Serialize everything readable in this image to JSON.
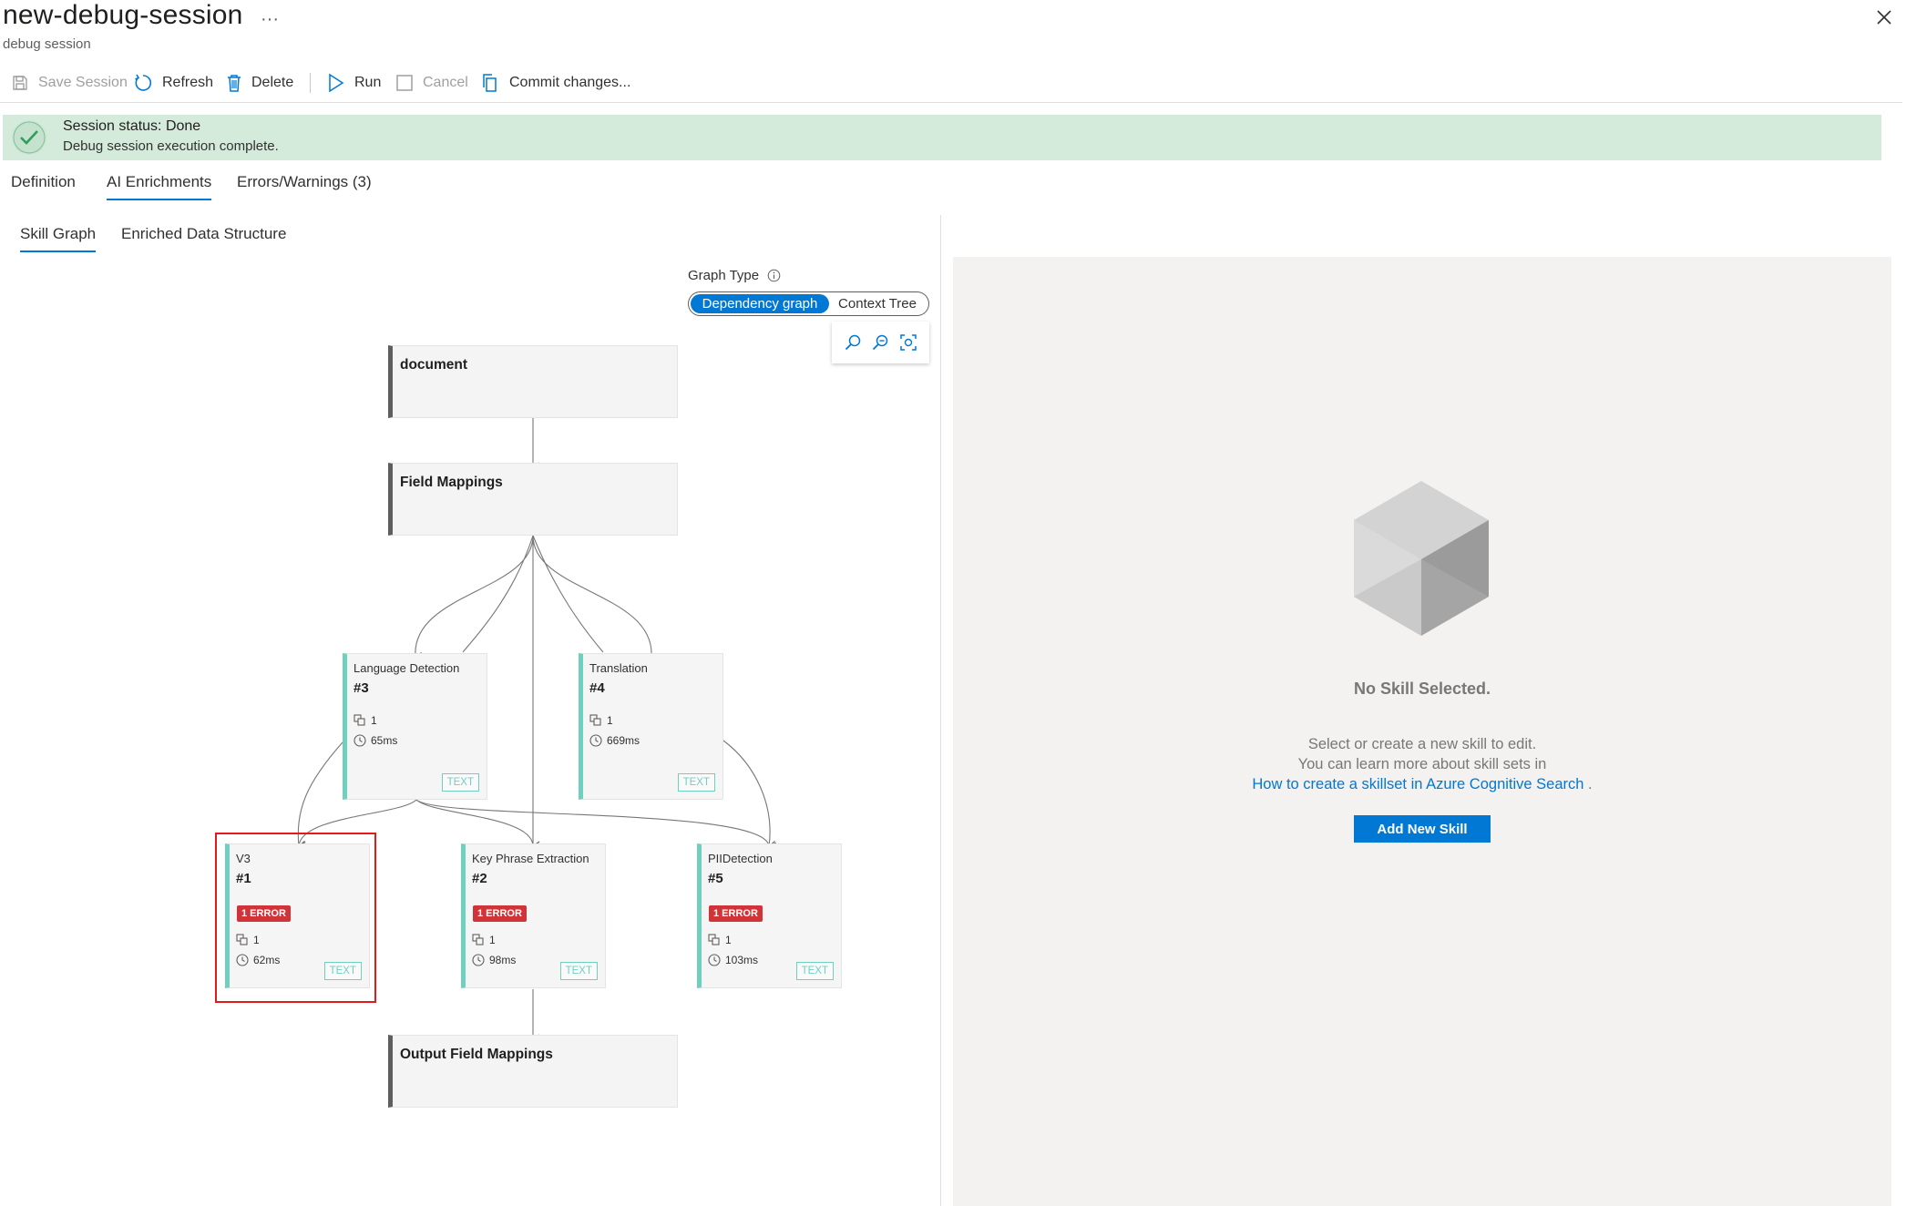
{
  "header": {
    "title": "new-debug-session",
    "subtitle": "debug session",
    "more_label": "···"
  },
  "toolbar": {
    "save_label": "Save Session",
    "refresh_label": "Refresh",
    "delete_label": "Delete",
    "run_label": "Run",
    "cancel_label": "Cancel",
    "commit_label": "Commit changes..."
  },
  "banner": {
    "title": "Session status: Done",
    "message": "Debug session execution complete."
  },
  "tabs": {
    "definition": "Definition",
    "ai_enrichments": "AI Enrichments",
    "errors": "Errors/Warnings (3)"
  },
  "subtabs": {
    "skill_graph": "Skill Graph",
    "enriched": "Enriched Data Structure"
  },
  "graph_type": {
    "label": "Graph Type",
    "dependency": "Dependency graph",
    "context_tree": "Context Tree"
  },
  "graph": {
    "document": "document",
    "field_mappings": "Field Mappings",
    "output_field_mappings": "Output Field Mappings",
    "skills": [
      {
        "name": "Language Detection",
        "number": "#3",
        "count": "1",
        "time": "65ms",
        "tag": "TEXT",
        "error": ""
      },
      {
        "name": "Translation",
        "number": "#4",
        "count": "1",
        "time": "669ms",
        "tag": "TEXT",
        "error": ""
      },
      {
        "name": "V3",
        "number": "#1",
        "count": "1",
        "time": "62ms",
        "tag": "TEXT",
        "error": "1 ERROR"
      },
      {
        "name": "Key Phrase Extraction",
        "number": "#2",
        "count": "1",
        "time": "98ms",
        "tag": "TEXT",
        "error": "1 ERROR"
      },
      {
        "name": "PIIDetection",
        "number": "#5",
        "count": "1",
        "time": "103ms",
        "tag": "TEXT",
        "error": "1 ERROR"
      }
    ]
  },
  "right_pane": {
    "title": "No Skill Selected.",
    "desc_line1": "Select or create a new skill to edit.",
    "desc_line2": "You can learn more about skill sets in",
    "link_text": "How to create a skillset in Azure Cognitive Search",
    "link_suffix": " .",
    "add_button": "Add New Skill"
  },
  "colors": {
    "accent": "#0078d4",
    "success_bg": "#d4ebdc",
    "success_icon": "#2f9e5a",
    "error": "#d13438",
    "skill_bar": "#6fd0c0",
    "highlight": "#e01b1b"
  },
  "icons": {
    "close": "close-icon",
    "save": "save-icon",
    "refresh": "refresh-icon",
    "delete": "delete-icon",
    "run": "play-icon",
    "cancel": "stop-icon",
    "commit": "copy-icon",
    "status": "checkmark-icon",
    "info": "info-icon",
    "zoom_in": "zoom-in-icon",
    "zoom_out": "zoom-out-icon",
    "fit": "fit-to-screen-icon",
    "cube": "cube-icon",
    "count": "fields-icon",
    "time": "clock-icon"
  }
}
